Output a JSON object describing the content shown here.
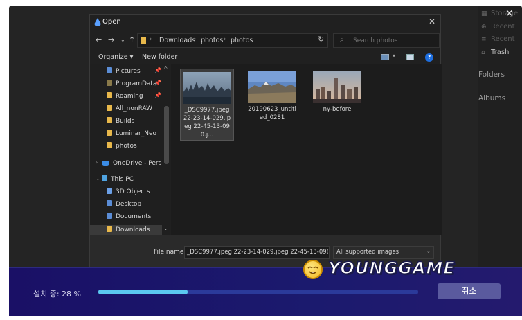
{
  "app": {
    "close_glyph": "✕",
    "sidebar": {
      "items": [
        {
          "label": "Storage",
          "icon": "storage-icon"
        },
        {
          "label": "Recent",
          "icon": "recent-icon"
        },
        {
          "label": "Recent",
          "icon": "filter-icon"
        },
        {
          "label": "Trash",
          "icon": "trash-icon"
        }
      ],
      "folders_heading": "Folders",
      "albums_heading": "Albums"
    }
  },
  "dialog": {
    "title": "Open",
    "close_glyph": "✕",
    "breadcrumbs": [
      "Downloads",
      "photos",
      "photos"
    ],
    "search_placeholder": "Search photos",
    "organize_label": "Organize ▾",
    "new_folder_label": "New folder",
    "nav_items": [
      {
        "label": "Pictures",
        "pinned": true
      },
      {
        "label": "ProgramData",
        "pinned": true
      },
      {
        "label": "Roaming",
        "pinned": true
      },
      {
        "label": "All_nonRAW"
      },
      {
        "label": "Builds"
      },
      {
        "label": "Luminar_Neo"
      },
      {
        "label": "photos"
      },
      {
        "label": "OneDrive - Person"
      },
      {
        "label": "This PC"
      },
      {
        "label": "3D Objects"
      },
      {
        "label": "Desktop"
      },
      {
        "label": "Documents"
      },
      {
        "label": "Downloads"
      }
    ],
    "files": [
      {
        "name": "_DSC9977.jpeg 22-23-14-029.jpeg 22-45-13-090.j...",
        "selected": true
      },
      {
        "name": "20190623_untitled_0281",
        "selected": false
      },
      {
        "name": "ny-before",
        "selected": false
      }
    ],
    "file_name_label": "File name:",
    "file_name_value": "_DSC9977.jpeg 22-23-14-029.jpeg 22-45-13-09(",
    "filter_value": "All supported images"
  },
  "installer": {
    "status_label": "설치 중: 28 %",
    "progress": 0.28,
    "cancel_label": "취소",
    "watermark": "YOUNGGAME"
  }
}
